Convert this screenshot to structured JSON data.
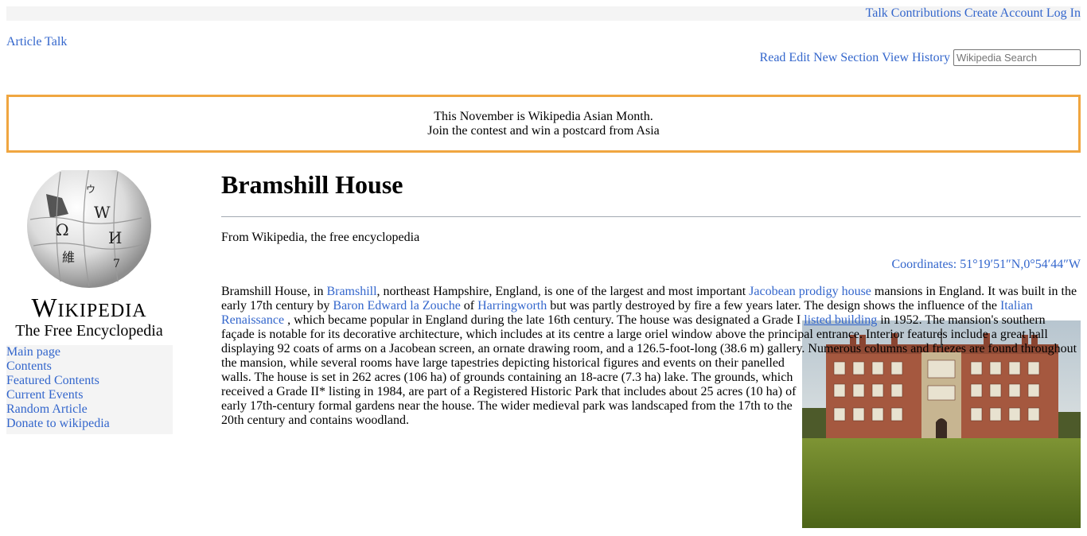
{
  "topbar": {
    "talk": "Talk",
    "contributions": "Contributions",
    "create_account": "Create Account",
    "log_in": "Log In"
  },
  "namespaces": {
    "article": "Article",
    "talk": "Talk"
  },
  "views": {
    "read": "Read",
    "edit": "Edit",
    "new_section": "New Section",
    "view_history": "View History",
    "search_placeholder": "Wikipedia Search"
  },
  "banner": {
    "line1": "This November is Wikipedia Asian Month.",
    "line2": "Join the contest and win a postcard from Asia"
  },
  "logo": {
    "wordmark": "Wikipedia",
    "tagline": "The Free Encyclopedia"
  },
  "sidebar": {
    "items": [
      {
        "label": "Main page"
      },
      {
        "label": "Contents"
      },
      {
        "label": "Featured Contents"
      },
      {
        "label": "Current Events"
      },
      {
        "label": "Random Article"
      },
      {
        "label": "Donate to wikipedia"
      }
    ]
  },
  "article": {
    "title": "Bramshill House",
    "tagline": "From Wikipedia, the free encyclopedia",
    "coordinates": "Coordinates: 51°19′51″N,0°54′44″W",
    "body": {
      "t1": "Bramshill House, in ",
      "l1": "Bramshill",
      "t2": ", northeast Hampshire, England, is one of the largest and most important ",
      "l2": "Jacobean prodigy house",
      "t3": " mansions in England. It was built in the early 17th century by ",
      "l3": "Baron Edward la Zouche",
      "t4": " of ",
      "l4": "Harringworth",
      "t5": " but was partly destroyed by fire a few years later. The design shows the influence of the ",
      "l5": "Italian Renaissance",
      "t6": " , which became popular in England during the late 16th century. The house was designated a Grade I ",
      "l6": "listed building",
      "t7": " in 1952. The mansion's southern façade is notable for its decorative architecture, which includes at its centre a large oriel window above the principal entrance. Interior features include a great hall displaying 92 coats of arms on a Jacobean screen, an ornate drawing room, and a 126.5-foot-long (38.6 m) gallery. Numerous columns and friezes are found throughout the mansion, while several rooms have large tapestries depicting historical figures and events on their panelled walls. The house is set in 262 acres (106 ha) of grounds containing an 18-acre (7.3 ha) lake. The grounds, which received a Grade II* listing in 1984, are part of a Registered Historic Park that includes about 25 acres (10 ha) of early 17th-century formal gardens near the house. The wider medieval park was landscaped from the 17th to the 20th century and contains woodland."
    }
  },
  "colors": {
    "link": "#3366cc",
    "banner_border": "#f0a640",
    "panel_bg": "#f4f4f4",
    "brick": "#a5583f",
    "lawn": "#5e7a22",
    "sky": "#c9d2d8"
  },
  "icons": {
    "logo": "wikipedia-globe-icon"
  }
}
